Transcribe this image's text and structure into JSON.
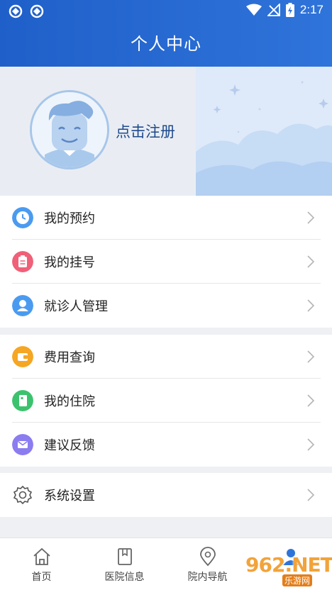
{
  "status_bar": {
    "time": "2:17"
  },
  "header": {
    "title": "个人中心"
  },
  "profile": {
    "register_label": "点击注册"
  },
  "groups": [
    [
      {
        "label": "我的预约",
        "icon": "clock-icon",
        "color": "#4a9bf0"
      },
      {
        "label": "我的挂号",
        "icon": "clipboard-icon",
        "color": "#f06078"
      },
      {
        "label": "就诊人管理",
        "icon": "person-icon",
        "color": "#4a9bf0"
      }
    ],
    [
      {
        "label": "费用查询",
        "icon": "wallet-icon",
        "color": "#f5a623"
      },
      {
        "label": "我的住院",
        "icon": "hospital-icon",
        "color": "#3cc26d"
      },
      {
        "label": "建议反馈",
        "icon": "mail-icon",
        "color": "#8b7cf0"
      }
    ],
    [
      {
        "label": "系统设置",
        "icon": "gear-icon",
        "color": "#666666"
      }
    ]
  ],
  "tabs": [
    {
      "label": "首页",
      "icon": "home-icon"
    },
    {
      "label": "医院信息",
      "icon": "book-icon"
    },
    {
      "label": "院内导航",
      "icon": "location-icon"
    },
    {
      "label": "",
      "icon": "user-icon",
      "active": true
    }
  ],
  "watermark": {
    "text": "962.NET",
    "sub": "乐游网"
  },
  "colors": {
    "primary": "#2f74da",
    "background": "#eef0f4"
  }
}
